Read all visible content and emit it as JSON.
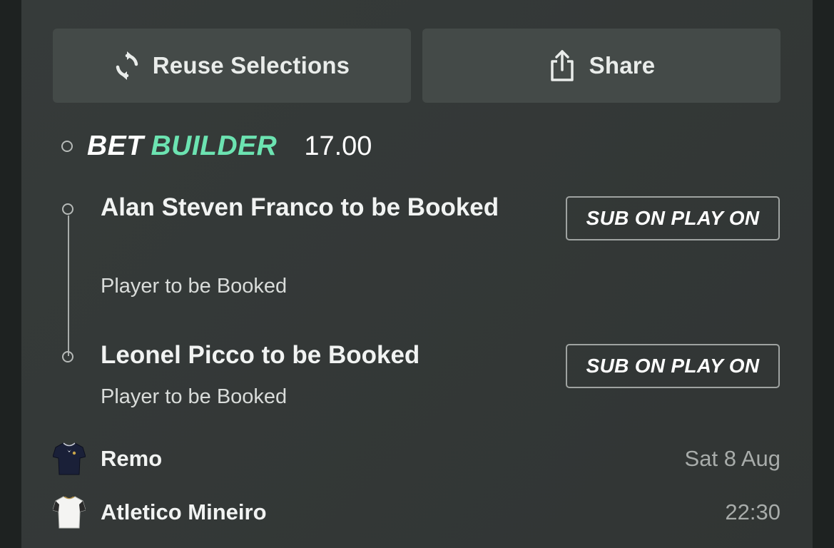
{
  "actions": {
    "reuse_label": "Reuse Selections",
    "share_label": "Share"
  },
  "bet_builder": {
    "logo_bet": "BET",
    "logo_builder": "BUILDER",
    "odds": "17.00",
    "accent_color": "#6ce3b1"
  },
  "selections": [
    {
      "title": "Alan Steven Franco to be Booked",
      "market": "Player to be Booked",
      "badge": "SUB ON PLAY ON"
    },
    {
      "title": "Leonel Picco to be Booked",
      "market": "Player to be Booked",
      "badge": "SUB ON PLAY ON"
    }
  ],
  "match": {
    "home": {
      "name": "Remo",
      "meta": "Sat 8 Aug",
      "shirt_icon": "navy-shirt-icon"
    },
    "away": {
      "name": "Atletico Mineiro",
      "meta": "22:30",
      "shirt_icon": "white-shirt-icon"
    }
  },
  "icons": {
    "reuse": "refresh-icon",
    "share": "share-icon"
  }
}
